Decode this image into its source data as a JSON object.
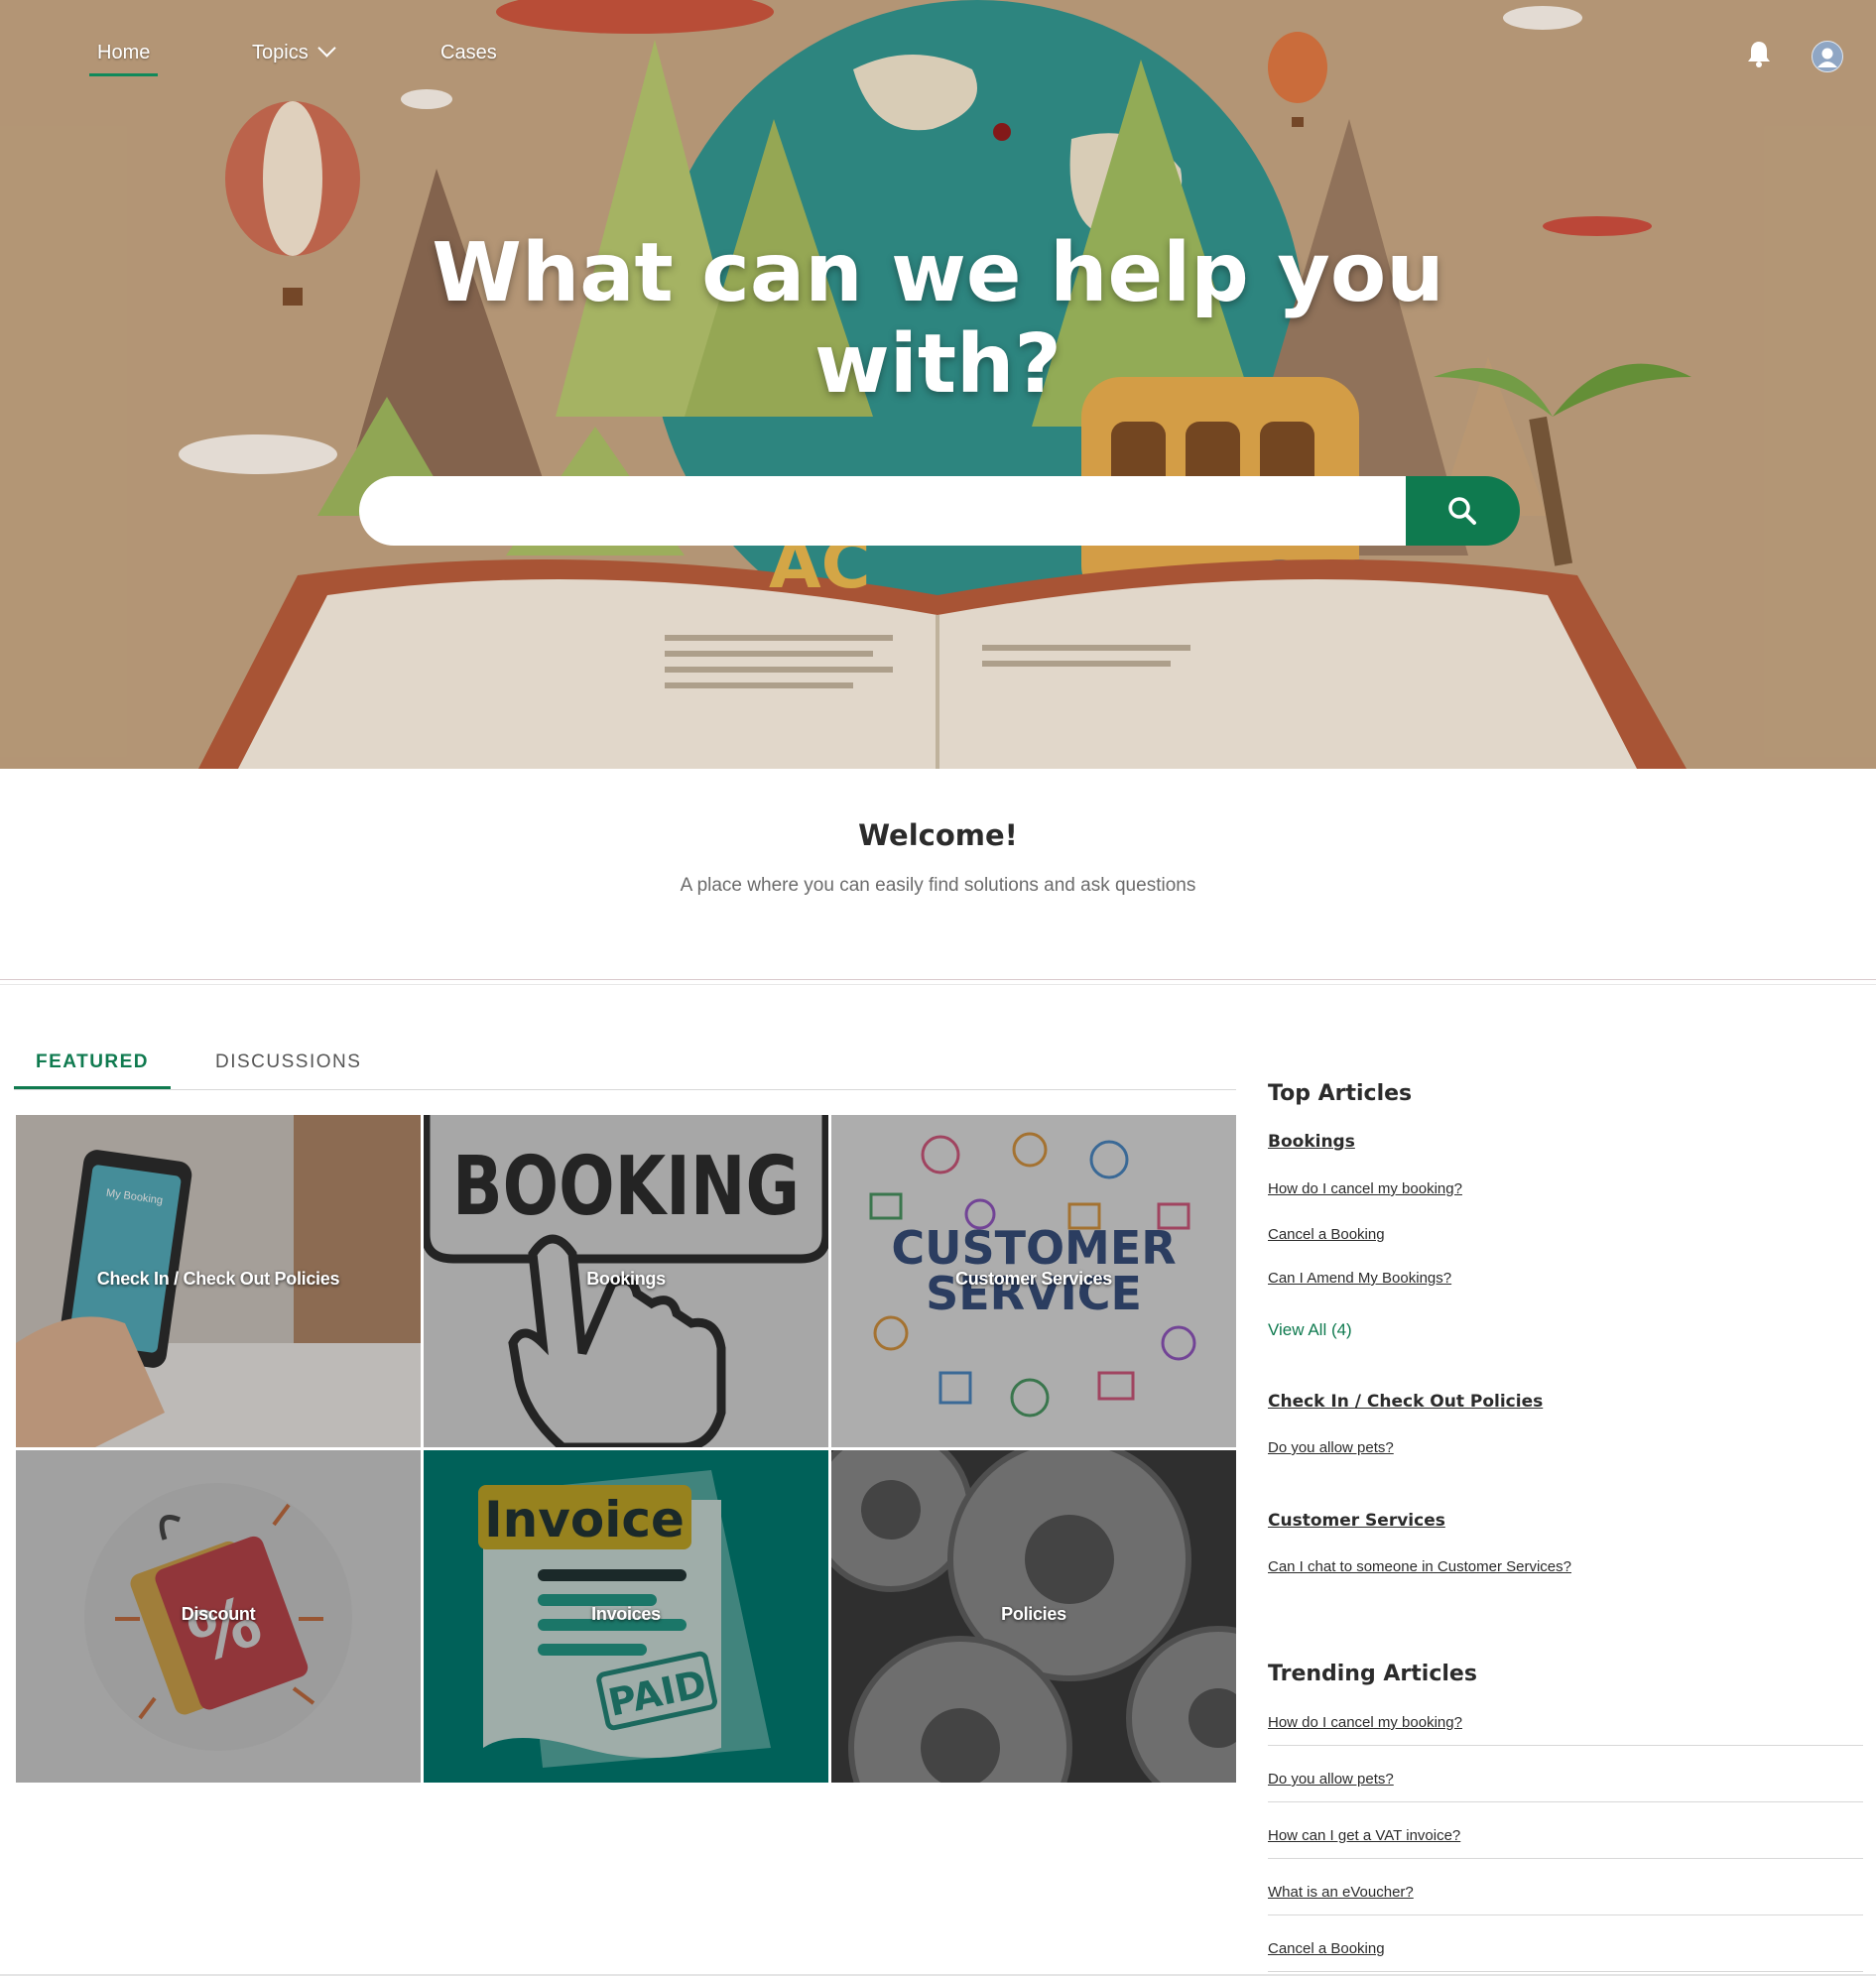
{
  "nav": {
    "home": "Home",
    "topics": "Topics",
    "cases": "Cases"
  },
  "hero": {
    "title_line1": "What can we help you",
    "title_line2": "with?",
    "search_placeholder": "",
    "banner_sign": "AC"
  },
  "welcome": {
    "title": "Welcome!",
    "subtitle": "A place where you can easily find solutions and ask questions"
  },
  "tabs": {
    "featured": "FEATURED",
    "discussions": "DISCUSSIONS"
  },
  "tiles": [
    {
      "label": "Check In / Check Out Policies",
      "screen_text": "My Booking"
    },
    {
      "label": "Bookings",
      "art_text": "BOOKING"
    },
    {
      "label": "Customer Services",
      "art_text_1": "CUSTOMER",
      "art_text_2": "SERVICE"
    },
    {
      "label": "Discount"
    },
    {
      "label": "Invoices",
      "art_text_1": "Invoice",
      "art_text_2": "PAID"
    },
    {
      "label": "Policies"
    }
  ],
  "top_articles": {
    "heading": "Top Articles",
    "groups": [
      {
        "category": "Bookings",
        "links": [
          "How do I cancel my booking?",
          "Cancel a Booking",
          "Can I Amend My Bookings?"
        ],
        "view_all": "View All (4)"
      },
      {
        "category": "Check In / Check Out Policies",
        "links": [
          "Do you allow pets?"
        ]
      },
      {
        "category": "Customer Services",
        "links": [
          "Can I chat to someone in Customer Services?"
        ]
      }
    ]
  },
  "trending_articles": {
    "heading": "Trending Articles",
    "links": [
      "How do I cancel my booking?",
      "Do you allow pets?",
      "How can I get a VAT invoice?",
      "What is an eVoucher?",
      "Cancel a Booking"
    ]
  },
  "colors": {
    "accent": "#0f7a4f",
    "hero_bg": "#b99a78"
  },
  "icons": {
    "bell": "bell-icon",
    "avatar": "user-avatar-icon",
    "search": "search-icon",
    "topics_chevron": "chevron-down-icon"
  }
}
